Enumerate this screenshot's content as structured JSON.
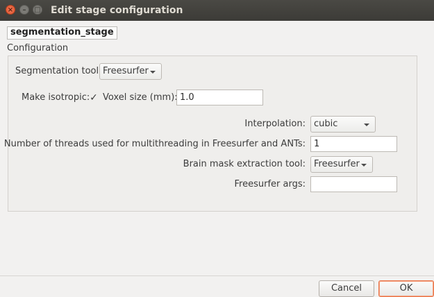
{
  "window": {
    "title": "Edit stage configuration"
  },
  "stage": {
    "name": "segmentation_stage"
  },
  "config": {
    "group_label": "Configuration",
    "segmentation_tool_label": "Segmentation tool:",
    "segmentation_tool_value": "Freesurfer",
    "make_isotropic_label": "Make isotropic:",
    "make_isotropic_checked": true,
    "check_glyph": "✓",
    "voxel_size_label": "Voxel size (mm):",
    "voxel_size_value": "1.0",
    "interpolation_label": "Interpolation:",
    "interpolation_value": "cubic",
    "threads_label": "Number of threads used for multithreading in Freesurfer and ANTs:",
    "threads_value": "1",
    "brain_mask_label": "Brain mask extraction tool:",
    "brain_mask_value": "Freesurfer",
    "freesurfer_args_label": "Freesurfer args:",
    "freesurfer_args_value": ""
  },
  "buttons": {
    "cancel": "Cancel",
    "ok": "OK"
  },
  "colors": {
    "titlebar": "#3c3b37",
    "close_button": "#e0552f",
    "ok_focus": "#e9764b"
  }
}
